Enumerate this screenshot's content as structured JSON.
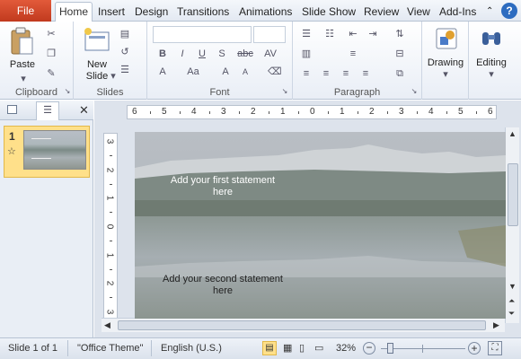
{
  "tabs": {
    "file": "File",
    "home": "Home",
    "items": [
      "Insert",
      "Design",
      "Transitions",
      "Animations",
      "Slide Show",
      "Review",
      "View",
      "Add-Ins"
    ]
  },
  "ribbon": {
    "clipboard": {
      "label": "Clipboard",
      "paste": "Paste"
    },
    "slides": {
      "label": "Slides",
      "new_slide_1": "New",
      "new_slide_2": "Slide"
    },
    "font": {
      "label": "Font"
    },
    "paragraph": {
      "label": "Paragraph"
    },
    "drawing": {
      "label": "Drawing"
    },
    "editing": {
      "label": "Editing"
    }
  },
  "thumb": {
    "number": "1",
    "star": "☆"
  },
  "slide": {
    "statement1": "Add your first statement here",
    "statement2": "Add your second statement here"
  },
  "ruler": {
    "horizontal": [
      "6",
      "5",
      "4",
      "3",
      "2",
      "1",
      "0",
      "1",
      "2",
      "3",
      "4",
      "5",
      "6"
    ],
    "vertical": [
      "3",
      "2",
      "1",
      "0",
      "1",
      "2",
      "3"
    ]
  },
  "status": {
    "slide": "Slide 1 of 1",
    "theme": "\"Office Theme\"",
    "lang": "English (U.S.)",
    "zoom": "32%"
  },
  "colors": {
    "file_tab": "#d2492a",
    "ribbon_border": "#b7c3d3",
    "thumb_highlight": "#ffe08a"
  }
}
